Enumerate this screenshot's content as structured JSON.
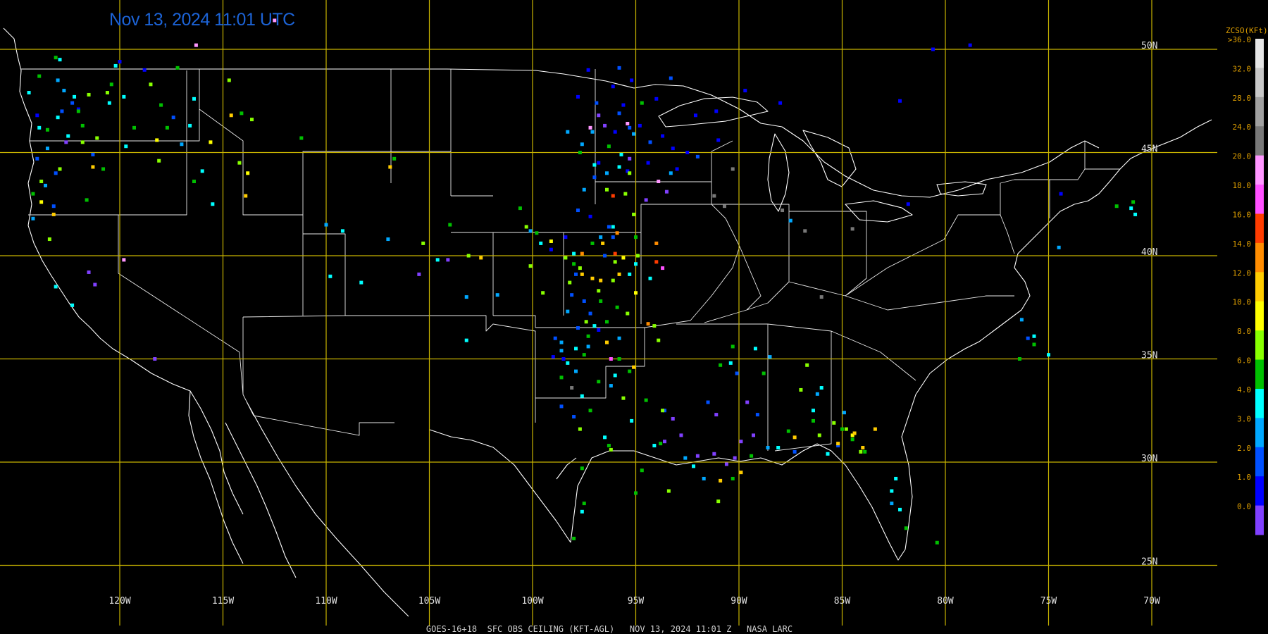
{
  "header": {
    "timestamp": "Nov 13, 2024 11:01 UTC"
  },
  "footer": {
    "caption": "GOES-16+18  SFC OBS CEILING (KFT-AGL)   NOV 13, 2024 11:01 Z   NASA LARC"
  },
  "grid": {
    "color": "#c8b400",
    "longitudes": [
      {
        "value": -120,
        "label": "120W"
      },
      {
        "value": -115,
        "label": "115W"
      },
      {
        "value": -110,
        "label": "110W"
      },
      {
        "value": -105,
        "label": "105W"
      },
      {
        "value": -100,
        "label": "100W"
      },
      {
        "value": -95,
        "label": "95W"
      },
      {
        "value": -90,
        "label": "90W"
      },
      {
        "value": -85,
        "label": "85W"
      },
      {
        "value": -80,
        "label": "80W"
      },
      {
        "value": -75,
        "label": "75W"
      },
      {
        "value": -70,
        "label": "70W"
      }
    ],
    "latitudes": [
      {
        "value": 50,
        "label": "50N"
      },
      {
        "value": 45,
        "label": "45N"
      },
      {
        "value": 40,
        "label": "40N"
      },
      {
        "value": 35,
        "label": "35N"
      },
      {
        "value": 30,
        "label": "30N"
      },
      {
        "value": 25,
        "label": "25N"
      }
    ]
  },
  "legend": {
    "title": "ZCSO(KFt)",
    "label_color": "#e0a000",
    "labels": [
      ">36.0",
      "32.0",
      "28.0",
      "24.0",
      "20.0",
      "18.0",
      "16.0",
      "14.0",
      "12.0",
      "10.0",
      "8.0",
      "6.0",
      "4.0",
      "3.0",
      "2.0",
      "1.0",
      "0.0"
    ],
    "bins": [
      "#e6e6e6",
      "#c8c8c8",
      "#a0a0a0",
      "#787878",
      "#ff96ff",
      "#ff50ff",
      "#ff3c00",
      "#ff8c00",
      "#ffcc00",
      "#ffff00",
      "#88ff00",
      "#00c000",
      "#00ffff",
      "#00a8ff",
      "#0050ff",
      "#0000ff",
      "#8040ff"
    ]
  },
  "stations_by_bin": {
    "0.0": [
      [
        -122.6,
        45.5
      ],
      [
        -121.5,
        39.2
      ],
      [
        -118.3,
        35.0
      ],
      [
        -121.2,
        38.6
      ],
      [
        -96.8,
        46.8
      ],
      [
        -96.5,
        46.3
      ],
      [
        -95.3,
        44.7
      ],
      [
        -93.5,
        43.1
      ],
      [
        -94.5,
        42.7
      ],
      [
        -104.1,
        39.8
      ],
      [
        -105.5,
        39.1
      ],
      [
        -93.2,
        32.1
      ],
      [
        -93.6,
        31.0
      ],
      [
        -92.0,
        30.3
      ],
      [
        -91.2,
        30.4
      ],
      [
        -90.6,
        29.9
      ],
      [
        -89.9,
        31.0
      ],
      [
        -91.1,
        32.3
      ],
      [
        -89.6,
        32.9
      ],
      [
        -89.3,
        31.3
      ],
      [
        -92.8,
        31.3
      ],
      [
        -90.2,
        30.2
      ]
    ],
    "1.0": [
      [
        -97.3,
        49.0
      ],
      [
        -96.1,
        48.2
      ],
      [
        -95.6,
        47.3
      ],
      [
        -94.8,
        46.3
      ],
      [
        -93.2,
        45.2
      ],
      [
        -92.1,
        46.8
      ],
      [
        -94.4,
        44.5
      ],
      [
        -93.0,
        44.2
      ],
      [
        -91.0,
        45.6
      ],
      [
        -91.1,
        47.0
      ],
      [
        -89.7,
        48.0
      ],
      [
        -94.0,
        47.6
      ],
      [
        -95.2,
        48.5
      ],
      [
        -97.8,
        47.7
      ],
      [
        -96.0,
        46.0
      ],
      [
        -92.5,
        45.0
      ],
      [
        -93.7,
        45.8
      ],
      [
        -96.8,
        44.5
      ],
      [
        -97.2,
        41.9
      ],
      [
        -98.4,
        40.9
      ],
      [
        -99.1,
        40.3
      ],
      [
        -98.5,
        35.0
      ],
      [
        -99.0,
        35.1
      ],
      [
        -95.4,
        44.1
      ],
      [
        -81.8,
        42.5
      ],
      [
        -82.2,
        47.5
      ],
      [
        -88.0,
        47.4
      ],
      [
        -80.6,
        50.0
      ],
      [
        -78.8,
        50.2
      ],
      [
        -120.0,
        49.4
      ],
      [
        -122.0,
        47.1
      ],
      [
        -124.0,
        46.8
      ],
      [
        -118.8,
        49.0
      ],
      [
        -74.4,
        43.0
      ],
      [
        -96.8,
        36.4
      ]
    ],
    "2.0": [
      [
        -92.0,
        44.8
      ],
      [
        -95.8,
        49.1
      ],
      [
        -93.3,
        48.6
      ],
      [
        -96.9,
        47.4
      ],
      [
        -95.8,
        46.9
      ],
      [
        -94.3,
        45.5
      ],
      [
        -97.0,
        43.8
      ],
      [
        -97.8,
        42.2
      ],
      [
        -96.3,
        41.4
      ],
      [
        -96.1,
        40.9
      ],
      [
        -98.1,
        38.1
      ],
      [
        -97.2,
        37.2
      ],
      [
        -97.8,
        36.5
      ],
      [
        -93.6,
        32.5
      ],
      [
        -90.1,
        34.3
      ],
      [
        -89.1,
        32.3
      ],
      [
        -87.3,
        30.5
      ],
      [
        -85.2,
        30.8
      ],
      [
        -95.3,
        46.2
      ],
      [
        -76.0,
        36.0
      ],
      [
        -98.6,
        32.7
      ],
      [
        -91.5,
        32.9
      ],
      [
        -122.3,
        47.4
      ],
      [
        -123.1,
        44.0
      ],
      [
        -124.0,
        44.7
      ],
      [
        -123.2,
        42.4
      ],
      [
        -122.8,
        47.0
      ],
      [
        -121.3,
        44.9
      ],
      [
        -117.4,
        46.7
      ],
      [
        -98.0,
        32.2
      ],
      [
        -96.5,
        40.0
      ],
      [
        -97.9,
        39.1
      ],
      [
        -97.5,
        37.8
      ],
      [
        -98.9,
        36.0
      ]
    ],
    "3.0": [
      [
        -123.0,
        48.5
      ],
      [
        -122.7,
        48.0
      ],
      [
        -124.2,
        41.8
      ],
      [
        -123.6,
        43.4
      ],
      [
        -117.0,
        45.4
      ],
      [
        -110.0,
        41.5
      ],
      [
        -107.0,
        40.8
      ],
      [
        -103.2,
        38.0
      ],
      [
        -101.7,
        38.1
      ],
      [
        -100.1,
        41.2
      ],
      [
        -97.5,
        43.2
      ],
      [
        -98.3,
        46.0
      ],
      [
        -97.1,
        46.0
      ],
      [
        -95.1,
        45.9
      ],
      [
        -93.3,
        44.0
      ],
      [
        -96.7,
        40.9
      ],
      [
        -98.3,
        37.3
      ],
      [
        -98.6,
        35.4
      ],
      [
        -97.3,
        35.6
      ],
      [
        -95.8,
        36.0
      ],
      [
        -92.6,
        30.2
      ],
      [
        -88.6,
        30.7
      ],
      [
        -91.7,
        29.2
      ],
      [
        -84.9,
        32.4
      ],
      [
        -82.6,
        28.0
      ],
      [
        -74.5,
        40.4
      ],
      [
        -76.3,
        36.9
      ],
      [
        -86.2,
        33.3
      ],
      [
        -88.5,
        35.1
      ],
      [
        -87.5,
        41.7
      ],
      [
        -123.5,
        45.2
      ],
      [
        -97.6,
        45.4
      ],
      [
        -96.4,
        44.0
      ],
      [
        -98.6,
        35.8
      ],
      [
        -97.9,
        34.4
      ],
      [
        -96.2,
        33.7
      ]
    ],
    "4.0": [
      [
        -124.4,
        47.9
      ],
      [
        -123.9,
        46.2
      ],
      [
        -123.0,
        46.7
      ],
      [
        -122.5,
        45.8
      ],
      [
        -120.5,
        47.4
      ],
      [
        -119.8,
        47.7
      ],
      [
        -116.0,
        44.1
      ],
      [
        -115.5,
        42.5
      ],
      [
        -109.8,
        39.0
      ],
      [
        -108.3,
        38.7
      ],
      [
        -104.6,
        39.8
      ],
      [
        -99.6,
        40.6
      ],
      [
        -98.0,
        40.1
      ],
      [
        -97.0,
        44.4
      ],
      [
        -95.8,
        44.3
      ],
      [
        -96.1,
        41.4
      ],
      [
        -95.3,
        39.1
      ],
      [
        -94.3,
        38.9
      ],
      [
        -97.0,
        36.6
      ],
      [
        -96.0,
        34.2
      ],
      [
        -97.9,
        35.5
      ],
      [
        -98.3,
        34.8
      ],
      [
        -97.6,
        33.2
      ],
      [
        -95.2,
        32.0
      ],
      [
        -94.1,
        30.8
      ],
      [
        -88.1,
        30.7
      ],
      [
        -85.7,
        30.4
      ],
      [
        -90.4,
        34.8
      ],
      [
        -89.2,
        35.5
      ],
      [
        -86.4,
        32.5
      ],
      [
        -86.0,
        33.6
      ],
      [
        -75.0,
        35.2
      ],
      [
        -75.7,
        36.1
      ],
      [
        -71.0,
        42.3
      ],
      [
        -70.8,
        42.0
      ],
      [
        -82.4,
        29.2
      ],
      [
        -82.6,
        28.6
      ],
      [
        -82.2,
        27.7
      ],
      [
        -92.2,
        29.8
      ],
      [
        -122.3,
        37.6
      ],
      [
        -123.1,
        38.5
      ],
      [
        -119.7,
        45.3
      ],
      [
        -116.6,
        46.3
      ],
      [
        -116.4,
        47.6
      ],
      [
        -120.2,
        49.2
      ],
      [
        -122.9,
        49.5
      ],
      [
        -122.2,
        47.7
      ],
      [
        -109.2,
        41.2
      ],
      [
        -103.2,
        35.9
      ],
      [
        -95.7,
        44.9
      ],
      [
        -95.0,
        39.6
      ],
      [
        -96.5,
        31.2
      ],
      [
        -97.6,
        27.6
      ]
    ],
    "6.0": [
      [
        -122.0,
        47.0
      ],
      [
        -123.1,
        49.6
      ],
      [
        -123.5,
        46.1
      ],
      [
        -121.8,
        46.3
      ],
      [
        -119.3,
        46.2
      ],
      [
        -116.4,
        43.6
      ],
      [
        -114.1,
        46.9
      ],
      [
        -124.2,
        43.0
      ],
      [
        -123.9,
        48.7
      ],
      [
        -120.4,
        48.3
      ],
      [
        -118.0,
        47.3
      ],
      [
        -117.7,
        46.2
      ],
      [
        -111.2,
        45.7
      ],
      [
        -106.7,
        44.7
      ],
      [
        -104.0,
        41.5
      ],
      [
        -100.6,
        42.3
      ],
      [
        -99.8,
        41.1
      ],
      [
        -97.1,
        40.6
      ],
      [
        -96.7,
        37.8
      ],
      [
        -97.5,
        35.2
      ],
      [
        -96.8,
        33.9
      ],
      [
        -97.2,
        32.5
      ],
      [
        -95.3,
        34.4
      ],
      [
        -96.3,
        30.8
      ],
      [
        -95.0,
        28.5
      ],
      [
        -94.7,
        29.6
      ],
      [
        -90.3,
        29.2
      ],
      [
        -89.4,
        30.3
      ],
      [
        -90.3,
        35.6
      ],
      [
        -88.8,
        34.3
      ],
      [
        -87.6,
        31.5
      ],
      [
        -86.4,
        32.0
      ],
      [
        -85.0,
        31.6
      ],
      [
        -83.9,
        30.5
      ],
      [
        -84.5,
        31.1
      ],
      [
        -76.4,
        35.0
      ],
      [
        -75.7,
        35.7
      ],
      [
        -71.7,
        42.4
      ],
      [
        -70.9,
        42.6
      ],
      [
        -81.9,
        26.8
      ],
      [
        -80.4,
        26.1
      ],
      [
        -120.8,
        44.2
      ],
      [
        -121.6,
        42.7
      ],
      [
        -117.2,
        49.1
      ],
      [
        -94.7,
        47.4
      ],
      [
        -97.7,
        45.0
      ],
      [
        -96.3,
        45.3
      ],
      [
        -95.0,
        40.9
      ],
      [
        -98.0,
        39.6
      ],
      [
        -97.3,
        36.1
      ],
      [
        -95.8,
        35.0
      ],
      [
        -98.6,
        34.1
      ],
      [
        -94.5,
        33.0
      ],
      [
        -93.8,
        30.9
      ],
      [
        -97.6,
        29.7
      ],
      [
        -98.0,
        26.3
      ],
      [
        -97.5,
        28.0
      ],
      [
        -96.4,
        36.8
      ],
      [
        -95.9,
        37.5
      ],
      [
        -90.9,
        34.7
      ]
    ],
    "8.0": [
      [
        -120.6,
        47.9
      ],
      [
        -123.8,
        43.6
      ],
      [
        -121.1,
        45.7
      ],
      [
        -122.9,
        44.2
      ],
      [
        -121.5,
        47.8
      ],
      [
        -118.1,
        44.6
      ],
      [
        -114.7,
        48.5
      ],
      [
        -113.6,
        46.6
      ],
      [
        -105.3,
        40.6
      ],
      [
        -103.1,
        40.0
      ],
      [
        -99.5,
        38.2
      ],
      [
        -96.4,
        43.2
      ],
      [
        -95.1,
        42.0
      ],
      [
        -97.7,
        39.4
      ],
      [
        -96.8,
        38.3
      ],
      [
        -96.1,
        38.8
      ],
      [
        -94.1,
        36.6
      ],
      [
        -93.9,
        35.9
      ],
      [
        -95.6,
        33.1
      ],
      [
        -93.7,
        32.5
      ],
      [
        -93.4,
        28.6
      ],
      [
        -91.0,
        28.1
      ],
      [
        -87.0,
        33.5
      ],
      [
        -86.7,
        34.7
      ],
      [
        -86.1,
        31.3
      ],
      [
        -84.8,
        31.6
      ],
      [
        -85.4,
        31.9
      ],
      [
        -84.1,
        30.5
      ],
      [
        -96.0,
        39.7
      ],
      [
        -98.4,
        39.9
      ],
      [
        -97.4,
        36.8
      ],
      [
        -95.4,
        37.2
      ],
      [
        -94.9,
        40.0
      ],
      [
        -100.3,
        41.4
      ],
      [
        -118.5,
        48.3
      ],
      [
        -123.4,
        40.8
      ],
      [
        -121.8,
        45.5
      ],
      [
        -114.2,
        44.5
      ],
      [
        -100.1,
        39.5
      ],
      [
        -98.2,
        38.7
      ],
      [
        -95.3,
        44.0
      ],
      [
        -95.5,
        43.0
      ],
      [
        -97.7,
        31.6
      ],
      [
        -96.2,
        30.6
      ]
    ],
    "10.0": [
      [
        -118.2,
        45.6
      ],
      [
        -113.8,
        44.0
      ],
      [
        -99.1,
        40.7
      ],
      [
        -95.6,
        39.9
      ],
      [
        -95.0,
        38.2
      ],
      [
        -84.5,
        31.3
      ],
      [
        -123.8,
        42.6
      ],
      [
        -115.6,
        45.5
      ]
    ],
    "12.0": [
      [
        -121.3,
        44.3
      ],
      [
        -114.6,
        46.8
      ],
      [
        -113.9,
        42.9
      ],
      [
        -106.9,
        44.3
      ],
      [
        -102.5,
        39.9
      ],
      [
        -97.6,
        39.1
      ],
      [
        -96.7,
        38.8
      ],
      [
        -95.8,
        39.1
      ],
      [
        -96.4,
        35.8
      ],
      [
        -95.1,
        34.6
      ],
      [
        -90.9,
        29.1
      ],
      [
        -89.9,
        29.5
      ],
      [
        -84.4,
        31.4
      ],
      [
        -84.0,
        30.7
      ],
      [
        -83.4,
        31.6
      ],
      [
        -85.2,
        30.9
      ],
      [
        -87.3,
        31.2
      ],
      [
        -96.6,
        40.6
      ],
      [
        -97.1,
        38.9
      ],
      [
        -123.2,
        42.0
      ]
    ],
    "14.0": [
      [
        -97.6,
        40.1
      ],
      [
        -94.4,
        36.7
      ],
      [
        -94.0,
        40.6
      ],
      [
        -95.9,
        41.1
      ]
    ],
    "16.0": [
      [
        -96.1,
        42.9
      ],
      [
        -94.0,
        39.7
      ],
      [
        -96.0,
        40.1
      ]
    ],
    "18.0": [
      [
        -93.7,
        39.4
      ],
      [
        -96.2,
        35.0
      ]
    ],
    "20.0": [
      [
        -116.3,
        50.2
      ],
      [
        -112.5,
        51.4
      ],
      [
        -119.8,
        39.8
      ],
      [
        -95.4,
        46.4
      ],
      [
        -97.2,
        46.2
      ],
      [
        -93.9,
        43.6
      ]
    ],
    "24.0": [
      [
        -98.1,
        33.6
      ],
      [
        -87.9,
        42.2
      ],
      [
        -86.8,
        41.2
      ],
      [
        -84.5,
        41.3
      ],
      [
        -86.0,
        38.0
      ],
      [
        -90.3,
        44.2
      ],
      [
        -91.2,
        42.9
      ],
      [
        -90.7,
        42.4
      ]
    ]
  }
}
